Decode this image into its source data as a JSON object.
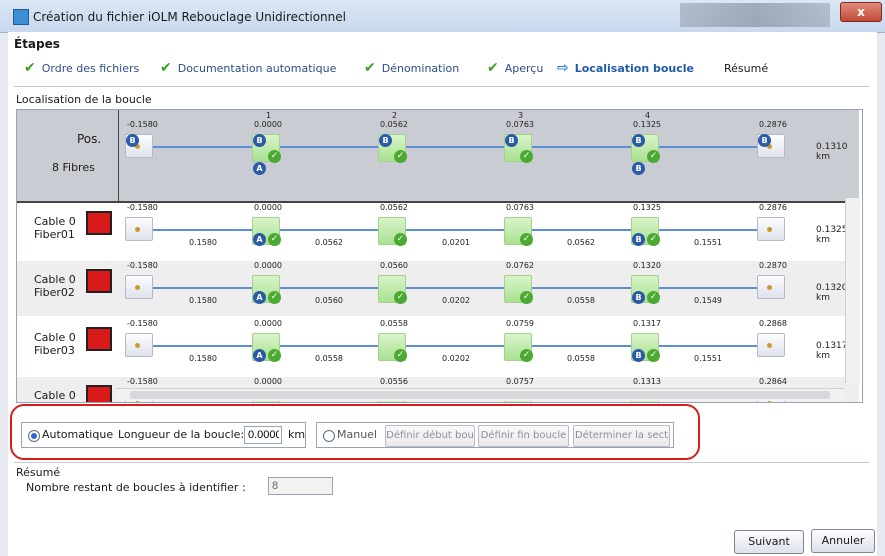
{
  "window": {
    "title": "Création du fichier iOLM Rebouclage Unidirectionnel",
    "close": "x"
  },
  "steps": {
    "title": "Étapes",
    "items": [
      {
        "label": "Ordre des fichiers",
        "state": "done"
      },
      {
        "label": "Documentation automatique",
        "state": "done"
      },
      {
        "label": "Dénomination",
        "state": "done"
      },
      {
        "label": "Aperçu",
        "state": "done"
      },
      {
        "label": "Localisation boucle",
        "state": "current"
      },
      {
        "label": "Résumé",
        "state": "pending"
      }
    ]
  },
  "section_label": "Localisation de la boucle",
  "header": {
    "pos_label": "Pos.",
    "fibers_label": "8 Fibres",
    "indices": [
      "1",
      "2",
      "3",
      "4"
    ],
    "positions": [
      "-0.1580",
      "0.0000",
      "0.0562",
      "0.0763",
      "0.1325",
      "0.2876"
    ],
    "total": "0.1310 km",
    "badges": {
      "b": "B",
      "a": "A"
    }
  },
  "fibers": [
    {
      "name": "Cable 0\nFiber01",
      "positions": [
        "-0.1580",
        "0.0000",
        "0.0562",
        "0.0763",
        "0.1325",
        "0.2876"
      ],
      "segments": [
        "0.1580",
        "0.0562",
        "0.0201",
        "0.0562",
        "0.1551"
      ],
      "total": "0.1325 km"
    },
    {
      "name": "Cable 0\nFiber02",
      "positions": [
        "-0.1580",
        "0.0000",
        "0.0560",
        "0.0762",
        "0.1320",
        "0.2870"
      ],
      "segments": [
        "0.1580",
        "0.0560",
        "0.0202",
        "0.0558",
        "0.1549"
      ],
      "total": "0.1320 km"
    },
    {
      "name": "Cable 0\nFiber03",
      "positions": [
        "-0.1580",
        "0.0000",
        "0.0558",
        "0.0759",
        "0.1317",
        "0.2868"
      ],
      "segments": [
        "0.1580",
        "0.0558",
        "0.0202",
        "0.0558",
        "0.1551"
      ],
      "total": "0.1317 km"
    },
    {
      "name": "Cable 0",
      "positions": [
        "-0.1580",
        "0.0000",
        "0.0556",
        "0.0757",
        "0.1313",
        "0.2864"
      ],
      "segments": [],
      "total": ""
    }
  ],
  "mode": {
    "auto_label": "Automatique",
    "auto_selected": true,
    "loop_length_label": "Longueur de la boucle:",
    "loop_length_value": "0.0000",
    "loop_length_unit": "km",
    "manual_label": "Manuel",
    "btn_begin": "Définir début bou",
    "btn_end": "Définir fin boucle",
    "btn_section": "Déterminer la sect"
  },
  "summary": {
    "title": "Résumé",
    "remaining_label": "Nombre restant de boucles à identifier :",
    "remaining_value": "8"
  },
  "footer": {
    "next": "Suivant",
    "cancel": "Annuler"
  },
  "colors": {
    "accent": "#1f5ba8",
    "check": "#3aa028",
    "highlight": "#d81d1d",
    "fiber_icon": "#d91a1a"
  }
}
